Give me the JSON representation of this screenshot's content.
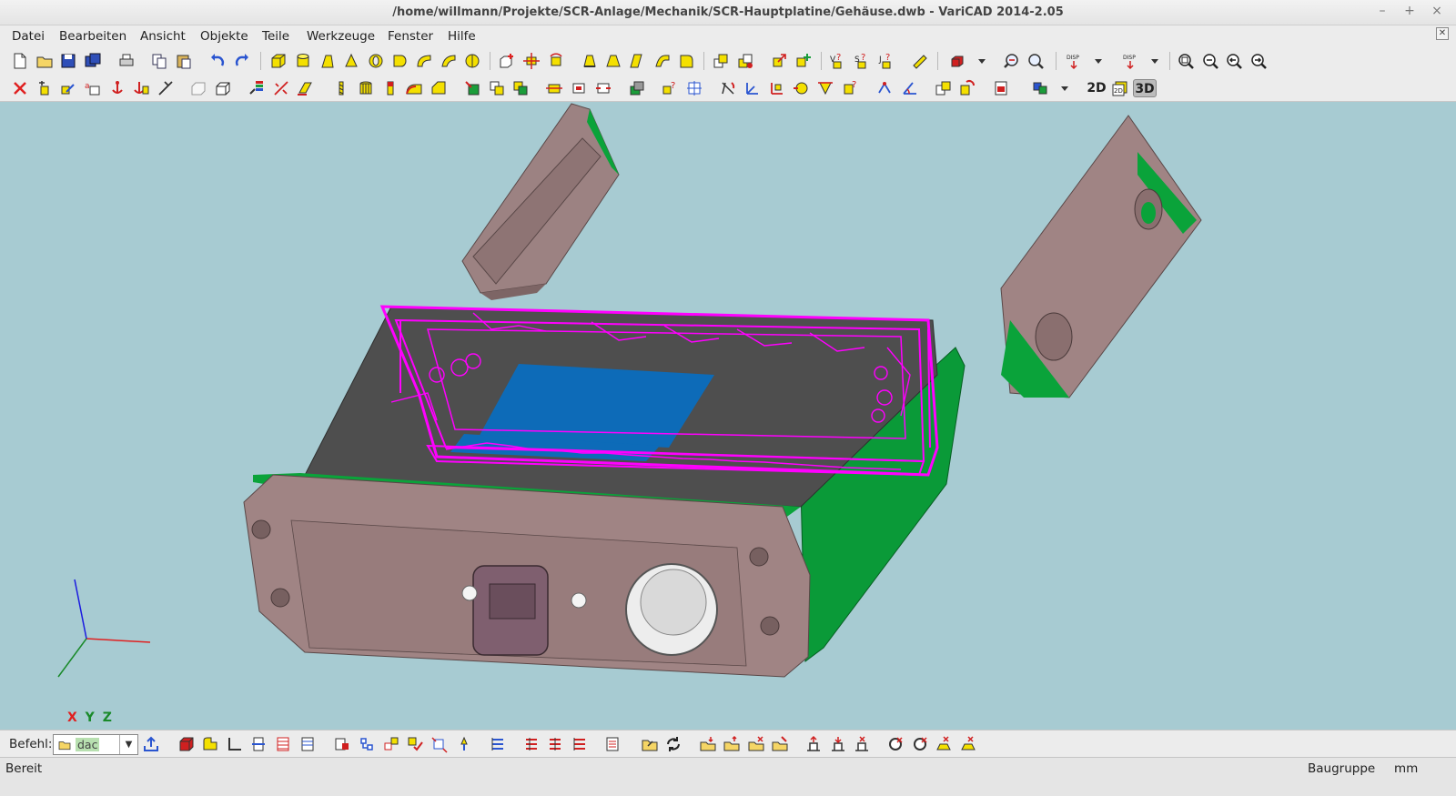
{
  "window": {
    "title": "/home/willmann/Projekte/SCR-Anlage/Mechanik/SCR-Hauptplatine/Gehäuse.dwb - VariCAD 2014-2.05",
    "minimize": "–",
    "maximize": "+",
    "close": "×"
  },
  "menu": {
    "items": [
      "Datei",
      "Bearbeiten",
      "Ansicht",
      "Objekte",
      "Teile",
      "Werkzeuge",
      "Fenster",
      "Hilfe"
    ]
  },
  "toolbar2": {
    "view_2d": "2D",
    "view_3d": "3D"
  },
  "icons": {
    "new": "new-file-icon",
    "open": "open-folder-icon",
    "save": "save-disk-icon",
    "print": "printer-icon",
    "undo": "undo-icon",
    "redo": "redo-icon",
    "zoom": "zoom-icon"
  },
  "axes": {
    "x": "X",
    "y": "Y",
    "z": "Z"
  },
  "command": {
    "label": "Befehl:",
    "value": "dac"
  },
  "status": {
    "left": "Bereit",
    "mode": "Baugruppe",
    "unit": "mm"
  },
  "colors": {
    "viewport_bg": "#a7cbd2",
    "housing": "#a08484",
    "seal_green": "#0aa33a",
    "selection_magenta": "#ff00ff",
    "display_blue": "#0d6bb8"
  }
}
